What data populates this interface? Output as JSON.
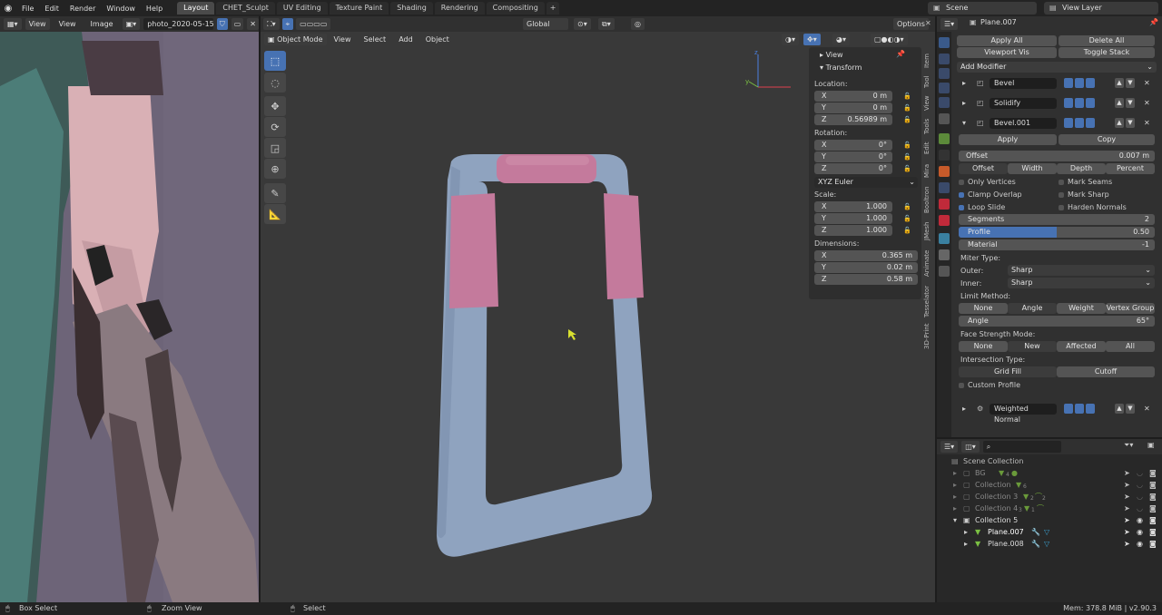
{
  "menus": [
    "File",
    "Edit",
    "Render",
    "Window",
    "Help"
  ],
  "workspace_tabs": [
    "Layout",
    "CHET_Sculpt",
    "UV Editing",
    "Texture Paint",
    "Shading",
    "Rendering",
    "Compositing"
  ],
  "scene": "Scene",
  "view_layer": "View Layer",
  "image_editor": {
    "view_btn": "View",
    "menu_view": "View",
    "menu_image": "Image",
    "image_name": "photo_2020-05-15_2..."
  },
  "viewport": {
    "mode": "Object Mode",
    "menu": [
      "View",
      "Select",
      "Add",
      "Object"
    ],
    "orientation": "Global",
    "options": "Options"
  },
  "npanel": {
    "view_label": "View",
    "transform_label": "Transform",
    "location_label": "Location:",
    "location": [
      {
        "k": "X",
        "v": "0 m"
      },
      {
        "k": "Y",
        "v": "0 m"
      },
      {
        "k": "Z",
        "v": "0.56989 m"
      }
    ],
    "rotation_label": "Rotation:",
    "rotation": [
      {
        "k": "X",
        "v": "0°"
      },
      {
        "k": "Y",
        "v": "0°"
      },
      {
        "k": "Z",
        "v": "0°"
      }
    ],
    "rotation_mode": "XYZ Euler",
    "scale_label": "Scale:",
    "scale": [
      {
        "k": "X",
        "v": "1.000"
      },
      {
        "k": "Y",
        "v": "1.000"
      },
      {
        "k": "Z",
        "v": "1.000"
      }
    ],
    "dimensions_label": "Dimensions:",
    "dimensions": [
      {
        "k": "X",
        "v": "0.365 m"
      },
      {
        "k": "Y",
        "v": "0.02 m"
      },
      {
        "k": "Z",
        "v": "0.58 m"
      }
    ],
    "tabs": [
      "Item",
      "Tool",
      "View",
      "Tools",
      "Edit",
      "Mira",
      "Booltron",
      "JMesh",
      "Animate",
      "Tesselator",
      "3D-Print"
    ]
  },
  "properties": {
    "object_name": "Plane.007",
    "apply_all": "Apply All",
    "delete_all": "Delete All",
    "viewport_vis": "Viewport Vis",
    "toggle_stack": "Toggle Stack",
    "add_modifier": "Add Modifier",
    "modifiers": [
      "Bevel",
      "Solidify",
      "Bevel.001",
      "Weighted Normal"
    ],
    "apply": "Apply",
    "copy": "Copy",
    "offset_label": "Offset",
    "offset_value": "0.007 m",
    "width_types": [
      "Offset",
      "Width",
      "Depth",
      "Percent"
    ],
    "only_vertices": "Only Vertices",
    "mark_seams": "Mark Seams",
    "clamp_overlap": "Clamp Overlap",
    "mark_sharp": "Mark Sharp",
    "loop_slide": "Loop Slide",
    "harden_normals": "Harden Normals",
    "segments_label": "Segments",
    "segments_value": "2",
    "profile_label": "Profile",
    "profile_value": "0.50",
    "profile_fraction": 0.5,
    "material_label": "Material",
    "material_value": "-1",
    "miter_type": "Miter Type:",
    "outer_label": "Outer:",
    "outer_value": "Sharp",
    "inner_label": "Inner:",
    "inner_value": "Sharp",
    "limit_method": "Limit Method:",
    "limit_options": [
      "None",
      "Angle",
      "Weight",
      "Vertex Group"
    ],
    "angle_label": "Angle",
    "angle_value": "65°",
    "face_strength": "Face Strength Mode:",
    "face_options": [
      "None",
      "New",
      "Affected",
      "All"
    ],
    "intersection": "Intersection Type:",
    "intersection_options": [
      "Grid Fill",
      "Cutoff"
    ],
    "custom_profile": "Custom Profile"
  },
  "outliner": {
    "rows": [
      {
        "name": "Scene Collection"
      },
      {
        "name": "BG"
      },
      {
        "name": "Collection"
      },
      {
        "name": "Collection 3"
      },
      {
        "name": "Collection 4"
      },
      {
        "name": "Collection 5"
      },
      {
        "name": "Plane.007"
      },
      {
        "name": "Plane.008"
      }
    ],
    "badges": [
      "4",
      "6",
      "2",
      "2",
      "3",
      "1"
    ]
  },
  "status": {
    "left": "Box Select",
    "mid": "Zoom View",
    "select": "Select",
    "right": "Mem: 378.8 MiB | v2.90.3"
  },
  "colors": {
    "accent": "#4772b3",
    "mesh_blue": "#8fa3bf",
    "mesh_pink": "#c47a9c"
  }
}
